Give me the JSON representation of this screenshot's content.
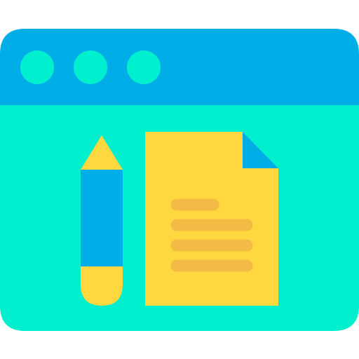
{
  "icon": {
    "name": "browser-document-edit-icon",
    "window": {
      "titlebar_color": "#00AEE7",
      "body_color": "#00F0CF",
      "window_buttons": [
        {
          "name": "window-dot-1",
          "color": "#00F0CF"
        },
        {
          "name": "window-dot-2",
          "color": "#00F0CF"
        },
        {
          "name": "window-dot-3",
          "color": "#00F0CF"
        }
      ]
    },
    "pencil": {
      "body_color": "#00AEE7",
      "tip_color": "#FFD73F",
      "eraser_color": "#FFD73F"
    },
    "document": {
      "page_color": "#FFD73F",
      "fold_color": "#00AEE7",
      "line_color": "#F4BA46",
      "text_lines": 4
    }
  }
}
